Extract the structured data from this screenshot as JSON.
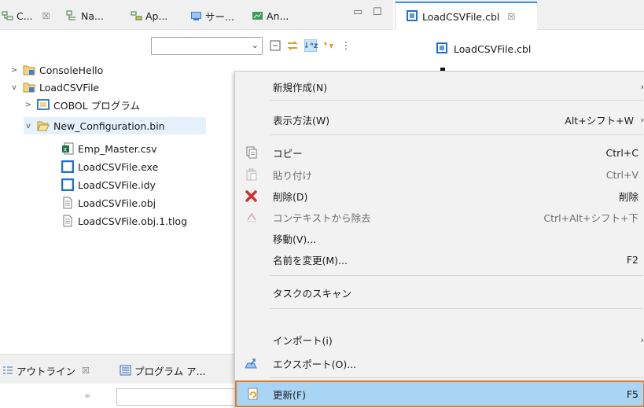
{
  "left_tabs": [
    {
      "label": "C...",
      "icon": "project-explorer-icon"
    },
    {
      "label": "Na...",
      "icon": "navigator-icon"
    },
    {
      "label": "Ap...",
      "icon": "application-icon"
    },
    {
      "label": "サー...",
      "icon": "server-icon"
    },
    {
      "label": "An...",
      "icon": "analysis-icon"
    }
  ],
  "tree": {
    "items": [
      {
        "label": "ConsoleHello",
        "icon": "cobol-project-icon",
        "twisty": ">"
      },
      {
        "label": "LoadCSVFile",
        "icon": "cobol-project-icon",
        "twisty": "v"
      },
      {
        "label": "COBOL プログラム",
        "icon": "cobol-program-folder-icon",
        "twisty": ">"
      },
      {
        "label": "New_Configuration.bin",
        "icon": "folder-open-icon",
        "twisty": "v"
      },
      {
        "label": "Emp_Master.csv",
        "icon": "excel-file-icon"
      },
      {
        "label": "LoadCSVFile.exe",
        "icon": "exe-file-icon"
      },
      {
        "label": "LoadCSVFile.idy",
        "icon": "idy-file-icon"
      },
      {
        "label": "LoadCSVFile.obj",
        "icon": "text-file-icon"
      },
      {
        "label": "LoadCSVFile.obj.1.tlog",
        "icon": "text-file-icon"
      }
    ]
  },
  "editor": {
    "tab_label": "LoadCSVFile.cbl",
    "breadcrumb_label": "LoadCSVFile.cbl"
  },
  "bottom_tabs": [
    {
      "label": "アウトライン",
      "icon": "outline-icon"
    },
    {
      "label": "プログラム ア...",
      "icon": "program-structure-icon"
    }
  ],
  "context_menu": {
    "items": [
      {
        "label": "新規作成(N)",
        "shortcut": "",
        "submenu": true
      },
      {
        "label": "表示方法(W)",
        "shortcut": "Alt+シフト+W",
        "submenu": true
      },
      {
        "label": "コピー",
        "shortcut": "Ctrl+C",
        "icon": "copy-icon"
      },
      {
        "label": "貼り付け",
        "shortcut": "Ctrl+V",
        "icon": "paste-icon",
        "disabled": true
      },
      {
        "label": "削除(D)",
        "shortcut": "削除",
        "icon": "delete-icon"
      },
      {
        "label": "コンテキストから除去",
        "shortcut": "Ctrl+Alt+シフト+下",
        "icon": "remove-context-icon",
        "disabled": true
      },
      {
        "label": "移動(V)...",
        "shortcut": ""
      },
      {
        "label": "名前を変更(M)...",
        "shortcut": "F2"
      },
      {
        "label": "タスクのスキャン",
        "shortcut": ""
      },
      {
        "label": "インポート(i)",
        "shortcut": "",
        "submenu": true
      },
      {
        "label": "エクスポート(O)...",
        "shortcut": "",
        "icon": "export-icon"
      },
      {
        "label": "更新(F)",
        "shortcut": "F5",
        "icon": "refresh-icon",
        "highlighted": true
      }
    ]
  },
  "colors": {
    "highlight": "#a9d5f5",
    "highlight_border": "#e8782b",
    "selection": "#e5f1fb",
    "delete_red": "#d0312d"
  }
}
